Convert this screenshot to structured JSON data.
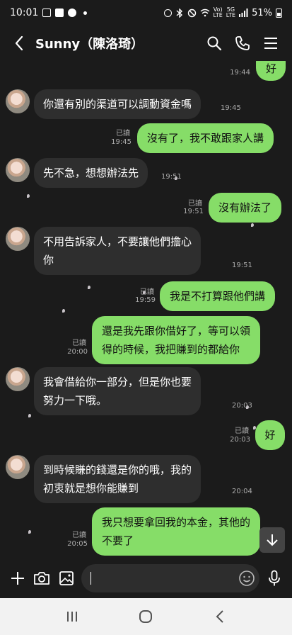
{
  "status_bar": {
    "time": "10:01",
    "battery": "51%",
    "network_label_1": "Vo)",
    "network_label_2": "LTE",
    "network_label_3": "5G",
    "network_label_4": "LTE"
  },
  "header": {
    "title": "Sunny（陳洛琦）"
  },
  "messages": [
    {
      "dir": "out",
      "text": "好",
      "time": "19:44",
      "read": ""
    },
    {
      "dir": "in",
      "text": "你還有別的渠道可以調動資金嗎",
      "time": "19:45"
    },
    {
      "dir": "out",
      "text": "沒有了，我不敢跟家人講",
      "time": "19:45",
      "read": "已讀"
    },
    {
      "dir": "in",
      "text": "先不急，想想辦法先",
      "time": "19:51"
    },
    {
      "dir": "out",
      "text": "沒有辦法了",
      "time": "19:51",
      "read": "已讀"
    },
    {
      "dir": "in",
      "text": "不用告訴家人，不要讓他們擔心你",
      "line1": "不用告訴家人，不要讓他們擔心",
      "line2": "你",
      "time": "19:51"
    },
    {
      "dir": "out",
      "text": "我是不打算跟他們講",
      "time": "19:59",
      "read": "已讀"
    },
    {
      "dir": "out",
      "text": "還是我先跟你借好了，等可以領得的時候，我把賺到的都給你",
      "line1": "還是我先跟你借好了，等可以領",
      "line2": "得的時候，我把賺到的都給你",
      "time": "20:00",
      "read": "已讀"
    },
    {
      "dir": "in",
      "text": "我會借給你一部分，但是你也要努力一下哦。",
      "line1": "我會借給你一部分，但是你也要",
      "line2": "努力一下哦。",
      "time": "20:03"
    },
    {
      "dir": "out",
      "text": "好",
      "time": "20:03",
      "read": "已讀"
    },
    {
      "dir": "in",
      "text": "到時候賺的錢還是你的哦，我的初衷就是想你能賺到",
      "line1": "到時候賺的錢還是你的哦，我的",
      "line2": "初衷就是想你能賺到",
      "time": "20:04"
    },
    {
      "dir": "out",
      "text": "我只想要拿回我的本金，其他的不要了",
      "line1": "我只想要拿回我的本金，其他的",
      "line2": "不要了",
      "time": "20:05",
      "read": "已讀"
    }
  ],
  "input": {
    "value": "",
    "placeholder": ""
  },
  "colors": {
    "background": "#1b1b1b",
    "incoming_bubble": "#2e2e2e",
    "outgoing_bubble": "#86dd68",
    "nav_bar": "#f2f2f2"
  },
  "icons": {
    "back": "chevron-left-icon",
    "search": "search-icon",
    "call": "phone-icon",
    "menu": "hamburger-menu-icon",
    "add": "plus-icon",
    "camera": "camera-icon",
    "gallery": "image-icon",
    "emoji": "smiley-icon",
    "mic": "microphone-icon",
    "scroll_down": "arrow-down-icon",
    "nav_recents": "recent-apps-icon",
    "nav_home": "home-icon",
    "nav_back": "nav-back-icon"
  }
}
